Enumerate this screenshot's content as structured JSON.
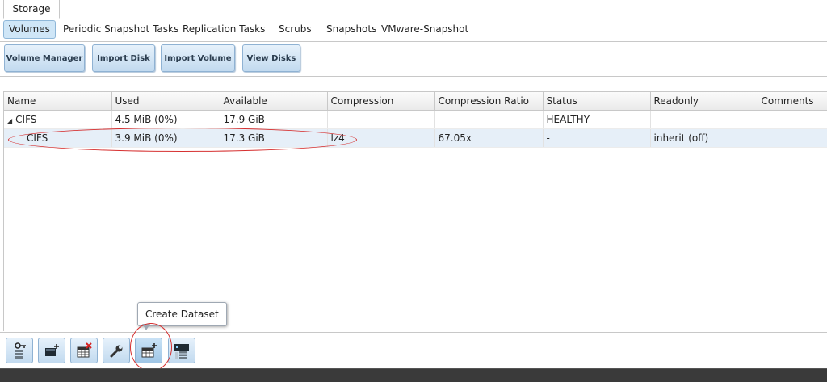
{
  "outer_tab": {
    "label": "Storage"
  },
  "subtabs": [
    {
      "label": "Volumes"
    },
    {
      "label": "Periodic Snapshot Tasks"
    },
    {
      "label": "Replication Tasks"
    },
    {
      "label": "Scrubs"
    },
    {
      "label": "Snapshots"
    },
    {
      "label": "VMware-Snapshot"
    }
  ],
  "buttons": {
    "volume_manager": "Volume Manager",
    "import_disk": "Import Disk",
    "import_volume": "Import Volume",
    "view_disks": "View Disks"
  },
  "grid": {
    "columns": [
      "Name",
      "Used",
      "Available",
      "Compression",
      "Compression Ratio",
      "Status",
      "Readonly",
      "Comments"
    ],
    "rows": [
      {
        "name": "CIFS",
        "used": "4.5 MiB (0%)",
        "available": "17.9 GiB",
        "compression": "-",
        "ratio": "-",
        "status": "HEALTHY",
        "readonly": "",
        "comments": ""
      },
      {
        "name": "CIFS",
        "used": "3.9 MiB (0%)",
        "available": "17.3 GiB",
        "compression": "lz4",
        "ratio": "67.05x",
        "status": "-",
        "readonly": "inherit (off)",
        "comments": ""
      }
    ]
  },
  "tooltip": {
    "text": "Create Dataset"
  },
  "colors": {
    "accent": "#cfe6f7",
    "annotation": "#d63030",
    "button_border": "#8fb2d3"
  }
}
